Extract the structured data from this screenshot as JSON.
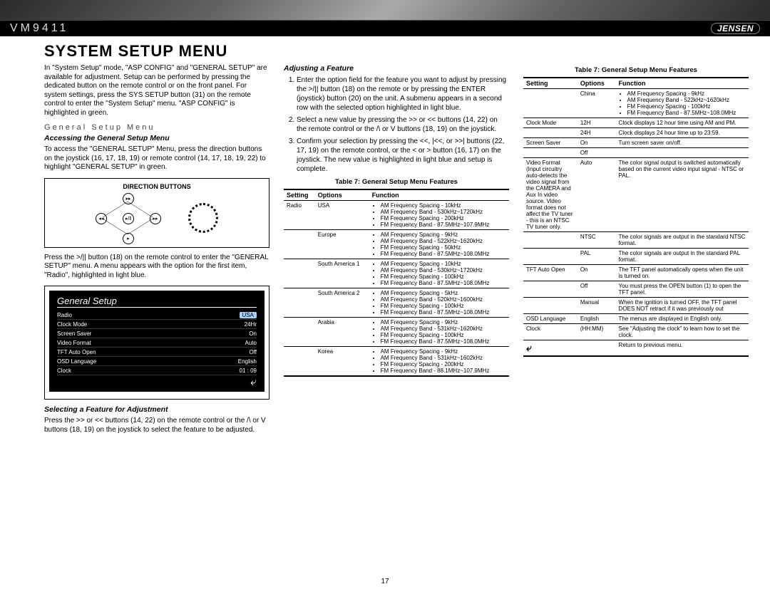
{
  "header": {
    "model": "VM9411",
    "brand": "JENSEN"
  },
  "title": "System Setup Menu",
  "intro": "In \"System Setup\" mode, \"ASP CONFIG\" and \"GENERAL SETUP\" are available for adjustment. Setup can be performed by pressing the dedicated button on the remote control or on the front panel. For system settings, press the SYS SETUP button (31) on the remote control to enter the \"System Setup\" menu. \"ASP CONFIG\" is highlighted in green.",
  "section_title": "General Setup Menu",
  "accessing": {
    "title": "Accessing the General Setup Menu",
    "body": "To access the \"GENERAL SETUP\" Menu, press the direction buttons on the joystick (16, 17, 18, 19) or remote control (14, 17, 18, 19, 22) to highlight \"GENERAL SETUP\" in green."
  },
  "direction_box_title": "DIRECTION BUTTONS",
  "osd": {
    "title": "General Setup",
    "rows": [
      {
        "label": "Radio",
        "value": "USA"
      },
      {
        "label": "Clock Mode",
        "value": "24Hr"
      },
      {
        "label": "Screen Saver",
        "value": "On"
      },
      {
        "label": "Video Format",
        "value": "Auto"
      },
      {
        "label": "TFT Auto Open",
        "value": "Off"
      },
      {
        "label": "OSD Language",
        "value": "English"
      },
      {
        "label": "Clock",
        "value": "01 : 09"
      }
    ],
    "return": "↵"
  },
  "press_enter": "Press the >/|| button (18) on the remote control to enter the \"GENERAL SETUP\" menu. A menu appears with the option for the first item, \"Radio\", highlighted in light blue.",
  "selecting": {
    "title": "Selecting a Feature for Adjustment",
    "body": "Press the >> or << buttons (14, 22) on the remote control or the /\\ or V buttons (18, 19) on the joystick to select the feature to be adjusted."
  },
  "adjusting": {
    "title": "Adjusting a Feature",
    "steps": [
      "Enter the option field for the feature you want to adjust by pressing the >/|| button (18) on the remote or by pressing the ENTER (joystick) button (20) on the unit. A submenu appears in a second row with the selected option highlighted in light blue.",
      "Select a new value by pressing the >> or << buttons (14, 22) on the remote control or the /\\ or V buttons (18, 19) on the joystick.",
      "Confirm your selection by pressing the <<, |<<, or >>| buttons (22, 17, 19) on the remote control, or the < or > button (16, 17) on the joystick. The new value is highlighted in light blue and setup is complete."
    ]
  },
  "table_caption": "Table 7: General Setup Menu Features",
  "table_headers": [
    "Setting",
    "Options",
    "Function"
  ],
  "radio_rows": [
    {
      "setting": "Radio",
      "option": "USA",
      "fns": [
        "AM Frequency Spacing - 10kHz",
        "AM Frequency Band - 530kHz~1720kHz",
        "FM Frequency Spacing - 200kHz",
        "FM Frequency Band - 87.5MHz~107.9MHz"
      ]
    },
    {
      "setting": "",
      "option": "Europe",
      "fns": [
        "AM Frequency Spacing - 9kHz",
        "AM Frequency Band - 522kHz~1620kHz",
        "FM Frequency Spacing - 50kHz",
        "FM Frequency Band - 87.5MHz~108.0MHz"
      ]
    },
    {
      "setting": "",
      "option": "South America 1",
      "fns": [
        "AM Frequency Spacing - 10kHz",
        "AM Frequency Band - 530kHz~1720kHz",
        "FM Frequency Spacing - 100kHz",
        "FM Frequency Band - 87.5MHz~108.0MHz"
      ]
    },
    {
      "setting": "",
      "option": "South America 2",
      "fns": [
        "AM Frequency Spacing - 5kHz",
        "AM Frequency Band - 520kHz~1600kHz",
        "FM Frequency Spacing - 100kHz",
        "FM Frequency Band - 87.5MHz~108.0MHz"
      ]
    },
    {
      "setting": "",
      "option": "Arabia",
      "fns": [
        "AM Frequency Spacing - 9kHz",
        "AM Frequency Band - 531kHz~1620kHz",
        "FM Frequency Spacing - 100kHz",
        "FM Frequency Band - 87.5MHz~108.0MHz"
      ]
    },
    {
      "setting": "",
      "option": "Korea",
      "fns": [
        "AM Frequency Spacing - 9kHz",
        "AM Frequency Band - 531kHz~1602kHz",
        "FM Frequency Spacing - 200kHz",
        "FM Frequency Band - 88.1MHz~107.9MHz"
      ]
    }
  ],
  "rest_rows": [
    {
      "setting": "",
      "option": "China",
      "fns": [
        "AM Frequency Spacing - 9kHz",
        "AM Frequency Band - 522kHz~1620kHz",
        "FM Frequency Spacing - 100kHz",
        "FM Frequency Band - 87.5MHz~108.0MHz"
      ]
    },
    {
      "setting": "Clock Mode",
      "option": "12H",
      "fn": "Clock displays 12 hour time using AM and PM."
    },
    {
      "setting": "",
      "option": "24H",
      "fn": "Clock displays 24 hour time up to 23:59."
    },
    {
      "setting": "Screen Saver",
      "option": "On",
      "fn": "Turn screen saver on/off."
    },
    {
      "setting": "",
      "option": "Off",
      "fn": ""
    },
    {
      "setting": "Video Format (Input circuitry auto-detects the video signal from the CAMERA and Aux In video source. Video format does not affect the TV tuner - this is an NTSC TV tuner only.",
      "option": "Auto",
      "fn": "The color signal output is switched automatically based on the current video input signal - NTSC or PAL."
    },
    {
      "setting": "",
      "option": "NTSC",
      "fn": "The color signals are output in the standard NTSC format."
    },
    {
      "setting": "",
      "option": "PAL",
      "fn": "The color signals are output in the standard PAL format."
    },
    {
      "setting": "TFT Auto Open",
      "option": "On",
      "fn": "The TFT panel automatically opens when the unit is turned on."
    },
    {
      "setting": "",
      "option": "Off",
      "fn": "You must press the OPEN button (1) to open the TFT panel."
    },
    {
      "setting": "",
      "option": "Manual",
      "fn": "When the ignition is turned OFF, the TFT panel DOES NOT retract if it was previously out"
    },
    {
      "setting": "OSD Language",
      "option": "English",
      "fn": "The menus are displayed in English only."
    },
    {
      "setting": "Clock",
      "option": "(HH:MM)",
      "fn": "See \"Adjusting the clock\" to learn how to set the clock."
    },
    {
      "setting": "↵",
      "option": "",
      "fn": "Return to previous menu."
    }
  ],
  "page_number": "17"
}
